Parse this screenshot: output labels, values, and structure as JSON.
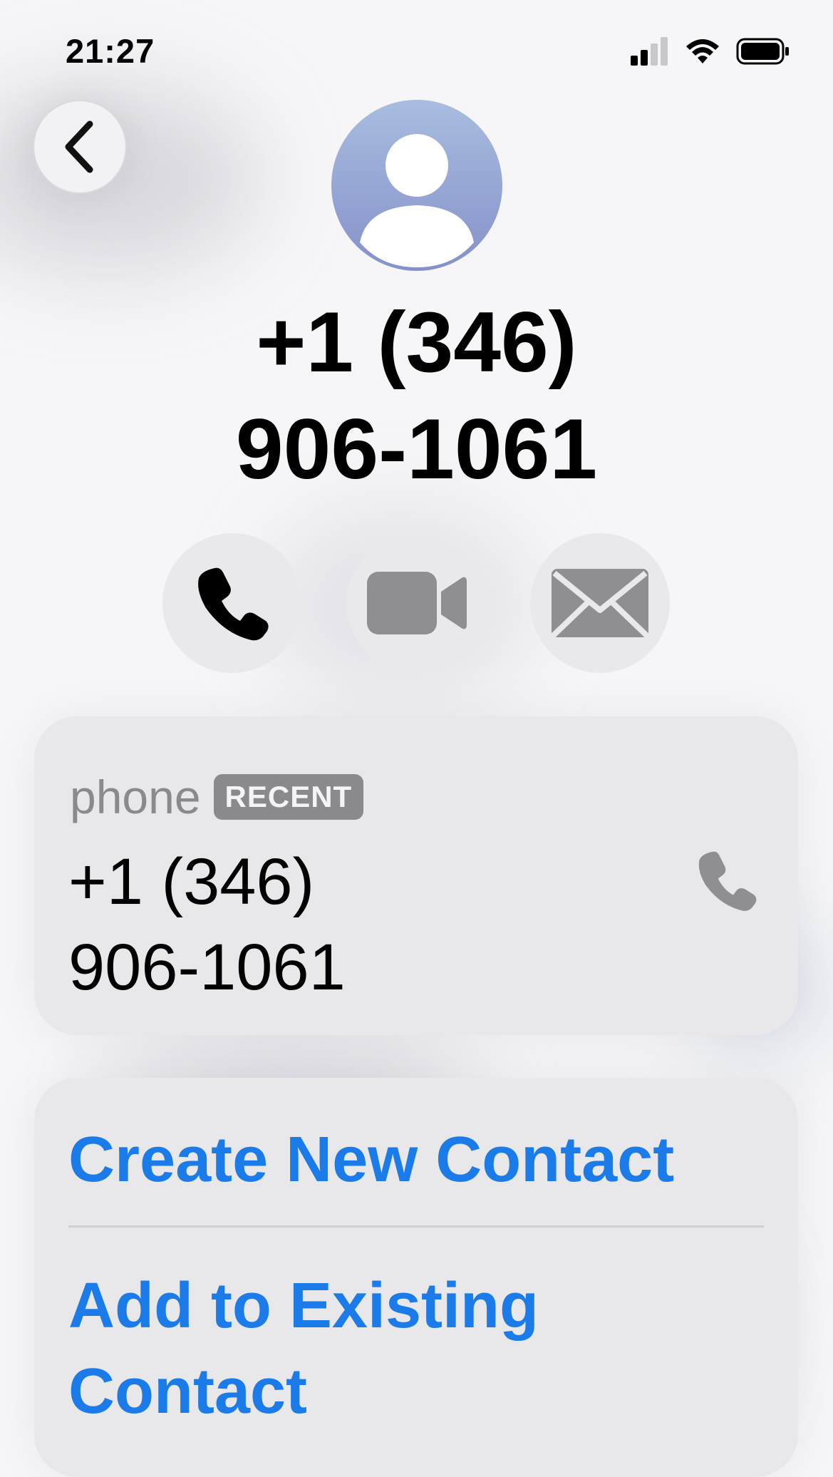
{
  "status_bar": {
    "time": "21:27",
    "icons": [
      "signal-icon",
      "wifi-icon",
      "battery-icon"
    ]
  },
  "header": {
    "back_icon": "chevron-left-icon",
    "avatar_icon": "person-icon"
  },
  "contact": {
    "title_line1": "+1 (346)",
    "title_line2": "906-1061"
  },
  "actions": {
    "call_icon": "phone-icon",
    "video_icon": "video-icon",
    "mail_icon": "mail-icon"
  },
  "phone_card": {
    "label": "phone",
    "badge": "RECENT",
    "number_line1": "+1 (346)",
    "number_line2": "906-1061",
    "call_icon": "phone-icon"
  },
  "options": {
    "create_new": "Create New Contact",
    "add_existing_line1": "Add to Existing",
    "add_existing_line2": "Contact"
  },
  "colors": {
    "accent": "#1b7be8",
    "secondary_text": "#8a8a8e",
    "card_bg": "#e8e8eb",
    "avatar_top": "#a8bde0",
    "avatar_bottom": "#8591c9"
  }
}
